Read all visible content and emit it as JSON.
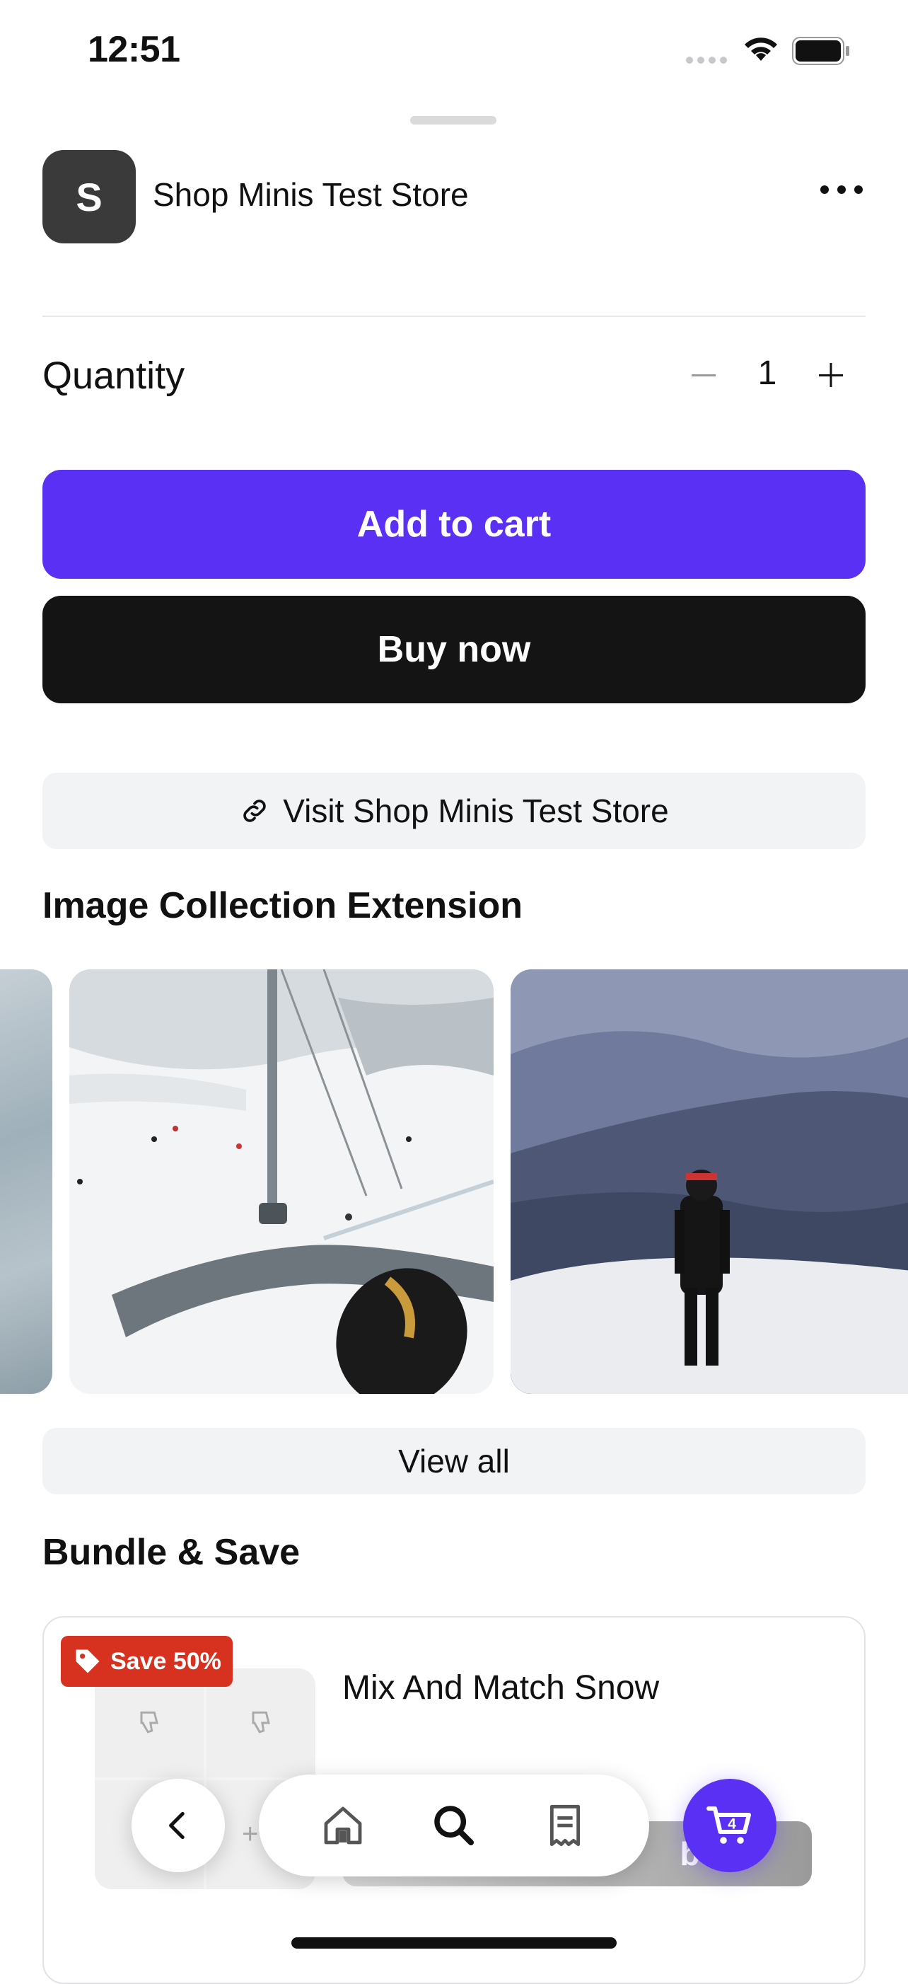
{
  "status_bar": {
    "time": "12:51"
  },
  "store": {
    "avatar_letter": "S",
    "name": "Shop Minis Test Store"
  },
  "quantity": {
    "label": "Quantity",
    "value": "1"
  },
  "actions": {
    "add_to_cart": "Add to cart",
    "buy_now": "Buy now",
    "visit_store": "Visit Shop Minis Test Store"
  },
  "image_collection": {
    "title": "Image Collection Extension",
    "view_all": "View all"
  },
  "bundle": {
    "title": "Bundle & Save",
    "badge": "Save 50%",
    "product": "Mix And Match Snow",
    "button": "bui"
  },
  "nav": {
    "cart_count": "4"
  },
  "colors": {
    "accent": "#5a31f4",
    "buy": "#141414",
    "badge": "#d7321f"
  }
}
